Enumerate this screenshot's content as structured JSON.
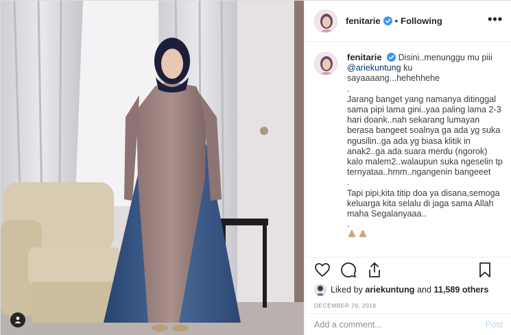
{
  "post": {
    "author": {
      "username": "fenitarie",
      "verified": true,
      "follow_status": "Following",
      "separator": "•"
    },
    "more_icon": "more-horizontal-icon",
    "caption": {
      "username": "fenitarie",
      "lines": [
        "Disini..menunggu mu piii",
        "ku sayaaaang...hehehhehe",
        ".",
        "Jarang banget yang namanya ditinggal sama pipi lama gini..yaa paling lama 2-3 hari doank..nah sekarang lumayan berasa bangeet soalnya ga ada yg suka ngusilin..ga ada yg biasa klitik in anak2..ga ada suara merdu (ngorok) kalo malem2..walaupun suka ngeselin tp ternyataa..hmm..ngangenin bangeeet",
        ".",
        "Tapi pipi,kita titip doa ya disana,semoga keluarga kita selalu di jaga sama Allah maha Segalanyaaa..",
        "."
      ],
      "mention": "@ariekuntung"
    },
    "actions": {
      "like_icon": "heart-icon",
      "comment_icon": "comment-icon",
      "share_icon": "share-icon",
      "save_icon": "bookmark-icon"
    },
    "likes": {
      "prefix": "Liked by",
      "user": "ariekuntung",
      "joiner": "and",
      "others": "11,589 others"
    },
    "date": "DECEMBER 29, 2018",
    "comment": {
      "placeholder": "Add a comment...",
      "post_label": "Post"
    }
  },
  "colors": {
    "mention": "#00376b",
    "verified": "#3897f0",
    "post_disabled": "#b3dbff",
    "meta_gray": "#8e8e8e"
  }
}
